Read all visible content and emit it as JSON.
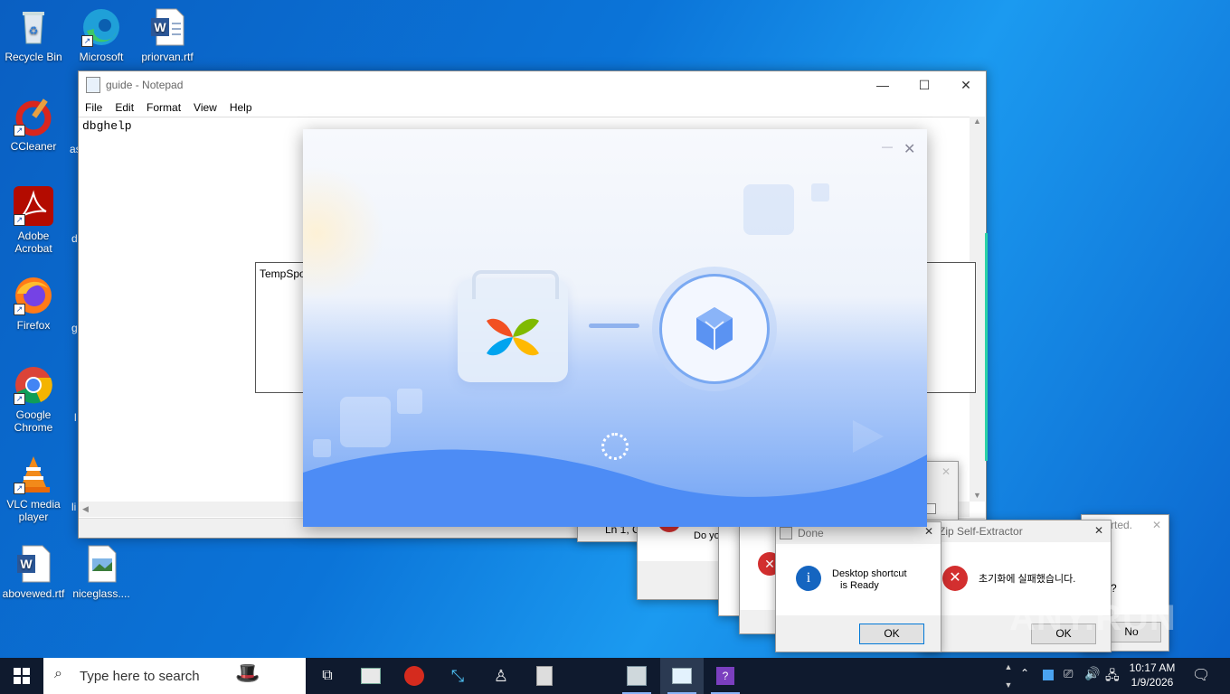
{
  "desktop": {
    "icons": [
      {
        "label": "Recycle Bin"
      },
      {
        "label": "Microsoft Edge"
      },
      {
        "label": "priorvan.rtf"
      },
      {
        "label": "CCleaner"
      },
      {
        "label": "Adobe Acrobat"
      },
      {
        "label": "Firefox"
      },
      {
        "label": "Google Chrome"
      },
      {
        "label": "VLC media player"
      },
      {
        "label": "abovewed.rtf"
      },
      {
        "label": "niceglass...."
      }
    ],
    "partial_icon_letters": [
      "as",
      "d",
      "g",
      "l",
      "li"
    ]
  },
  "notepad": {
    "title": "guide - Notepad",
    "menu": [
      "File",
      "Edit",
      "Format",
      "View",
      "Help"
    ],
    "content": "dbghelp",
    "status_partial": "Ln 1, C"
  },
  "temp_window": {
    "label": "TempSpo"
  },
  "installer": {
    "minimize": "—",
    "close": "✕"
  },
  "dialogs": {
    "back_dialog_text": "Do yo",
    "done": {
      "title": "Done",
      "message_line1": "Desktop shortcut",
      "message_line2": "is Ready",
      "ok": "OK"
    },
    "extractor": {
      "title": "Zip Self-Extractor",
      "message": "초기화에 실패했습니다.",
      "ok": "OK"
    },
    "right_partial": {
      "text1": "rted.",
      "text2": "?",
      "no": "No"
    }
  },
  "taskbar": {
    "search_placeholder": "Type here to search",
    "time": "10:17 AM",
    "date": "1/9/2026"
  },
  "watermark": "ANY.RUN",
  "colors": {
    "accent": "#0078d7",
    "taskbar": "#0f1a2e",
    "installer_blue": "#4d8cf5"
  }
}
